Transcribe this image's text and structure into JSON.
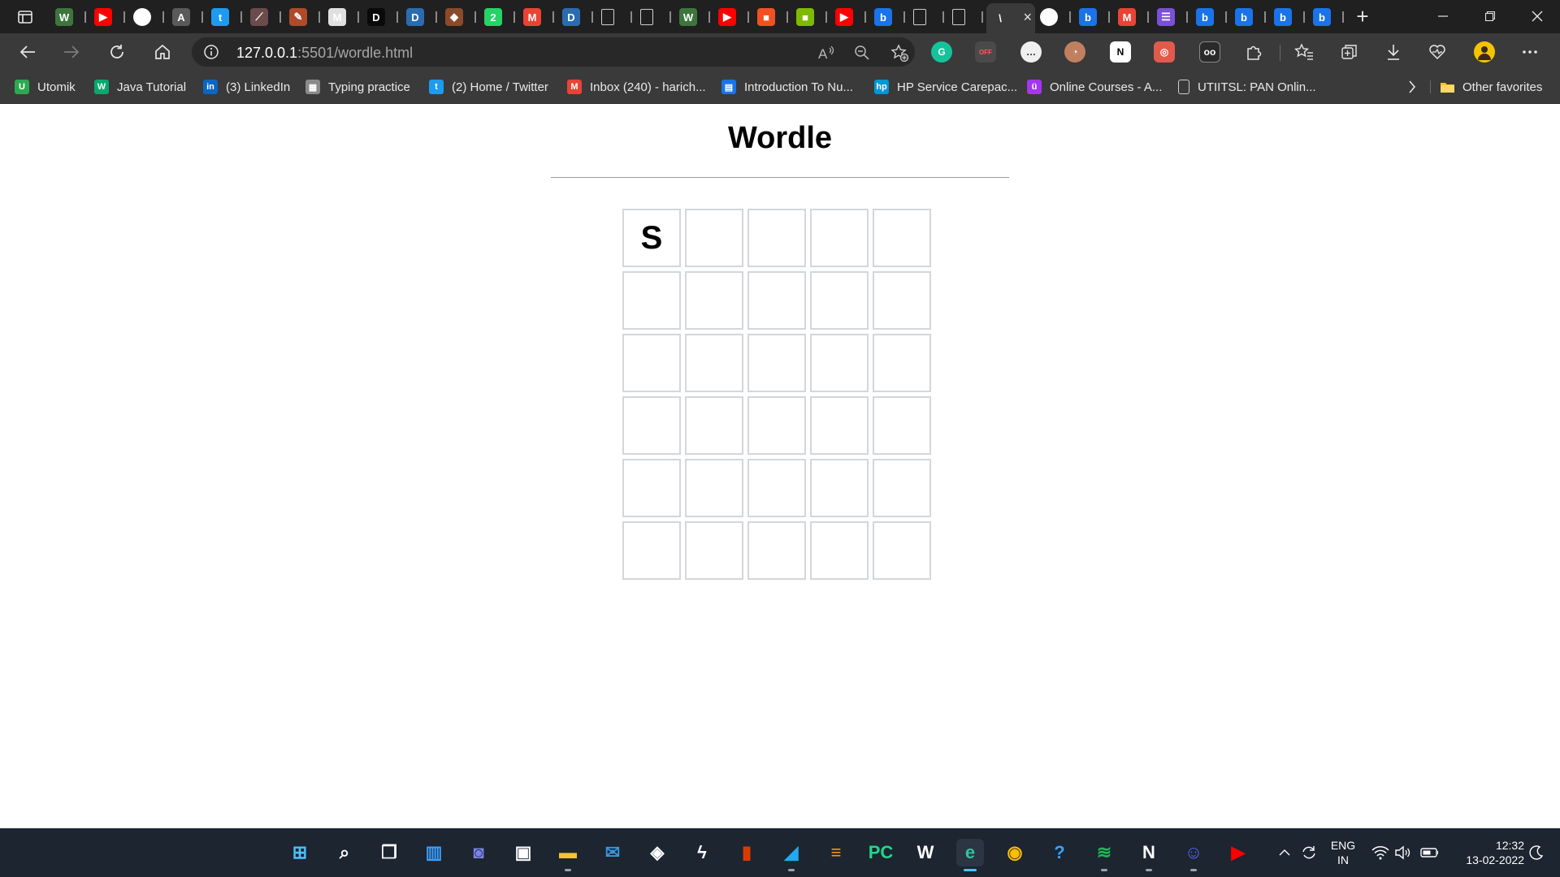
{
  "browser": {
    "tabs": [
      {
        "icon": "wikipedia-w-icon",
        "color": "#3c763d",
        "glyph": "W"
      },
      {
        "icon": "youtube-icon",
        "color": "#ff0000",
        "glyph": "▶"
      },
      {
        "icon": "github-icon",
        "color": "#ffffff",
        "glyph": ""
      },
      {
        "icon": "atlassian-a-icon",
        "color": "#5a5a5a",
        "glyph": "A"
      },
      {
        "icon": "twitter-icon",
        "color": "#1d9bf0",
        "glyph": "t"
      },
      {
        "icon": "feather-icon",
        "color": "#6b4b4b",
        "glyph": "⟋"
      },
      {
        "icon": "pencil-icon",
        "color": "#b04a2a",
        "glyph": "✎"
      },
      {
        "icon": "mw-icon",
        "color": "#e0e0e0",
        "glyph": "M"
      },
      {
        "icon": "dev-d-icon",
        "color": "#0a0a0a",
        "glyph": "D"
      },
      {
        "icon": "dev-d-blue-icon",
        "color": "#2b6cb0",
        "glyph": "D"
      },
      {
        "icon": "fox-icon",
        "color": "#8a4b2a",
        "glyph": "◆"
      },
      {
        "icon": "whatsapp-icon",
        "color": "#25d366",
        "glyph": "2"
      },
      {
        "icon": "gmail-icon",
        "color": "#ea4335",
        "glyph": "M"
      },
      {
        "icon": "dev-d-blue-icon",
        "color": "#2b6cb0",
        "glyph": "D"
      },
      {
        "icon": "document-icon",
        "color": "#5a5a5a",
        "glyph": ""
      },
      {
        "icon": "document-icon",
        "color": "#5a5a5a",
        "glyph": ""
      },
      {
        "icon": "wikipedia-w-icon",
        "color": "#3c763d",
        "glyph": "W"
      },
      {
        "icon": "youtube-icon",
        "color": "#ff0000",
        "glyph": "▶"
      },
      {
        "icon": "microsoft-icon",
        "color": "#f25022",
        "glyph": "■"
      },
      {
        "icon": "microsoft-icon",
        "color": "#7fba00",
        "glyph": "■"
      },
      {
        "icon": "youtube-icon",
        "color": "#ff0000",
        "glyph": "▶"
      },
      {
        "icon": "bing-icon",
        "color": "#1a73e8",
        "glyph": "b"
      },
      {
        "icon": "document-icon",
        "color": "#5a5a5a",
        "glyph": ""
      },
      {
        "icon": "document-sync-icon",
        "color": "#5a5a5a",
        "glyph": ""
      },
      {
        "icon": "active-tab-icon",
        "color": "#3a3a3a",
        "glyph": "\\",
        "active": true
      },
      {
        "icon": "github-icon",
        "color": "#ffffff",
        "glyph": ""
      },
      {
        "icon": "bing-icon",
        "color": "#1a73e8",
        "glyph": "b"
      },
      {
        "icon": "gmail-icon",
        "color": "#ea4335",
        "glyph": "M"
      },
      {
        "icon": "list-icon",
        "color": "#7b4fd9",
        "glyph": "☰"
      },
      {
        "icon": "bing-icon",
        "color": "#1a73e8",
        "glyph": "b"
      },
      {
        "icon": "bing-icon",
        "color": "#1a73e8",
        "glyph": "b"
      },
      {
        "icon": "bing-icon",
        "color": "#1a73e8",
        "glyph": "b"
      },
      {
        "icon": "bing-icon",
        "color": "#1a73e8",
        "glyph": "b"
      }
    ],
    "new_tab_label": "+",
    "address": {
      "host": "127.0.0.1",
      "path": ":5501/wordle.html"
    },
    "favorites": [
      {
        "label": "Utomik",
        "icon": "utomik-icon",
        "color": "#2ea84f",
        "glyph": "U"
      },
      {
        "label": "Java Tutorial",
        "icon": "w3schools-icon",
        "color": "#04aa6d",
        "glyph": "W"
      },
      {
        "label": "(3) LinkedIn",
        "icon": "linkedin-icon",
        "color": "#0a66c2",
        "glyph": "in"
      },
      {
        "label": "Typing practice",
        "icon": "keyboard-icon",
        "color": "#8a8a8a",
        "glyph": "▦"
      },
      {
        "label": "(2) Home / Twitter",
        "icon": "twitter-icon",
        "color": "#1d9bf0",
        "glyph": "t"
      },
      {
        "label": "Inbox (240) - harich...",
        "icon": "gmail-icon",
        "color": "#ea4335",
        "glyph": "M"
      },
      {
        "label": "Introduction To Nu...",
        "icon": "notebook-icon",
        "color": "#1a73e8",
        "glyph": "▤"
      },
      {
        "label": "HP Service Carepac...",
        "icon": "hp-icon",
        "color": "#0096d6",
        "glyph": "hp"
      },
      {
        "label": "Online Courses - A...",
        "icon": "udemy-icon",
        "color": "#a435f0",
        "glyph": "ü"
      },
      {
        "label": "UTIITSL: PAN Onlin...",
        "icon": "document-icon",
        "color": "#5a5a5a",
        "glyph": ""
      }
    ],
    "other_favorites_label": "Other favorites"
  },
  "page": {
    "title": "Wordle",
    "board": [
      [
        "S",
        "",
        "",
        "",
        ""
      ],
      [
        "",
        "",
        "",
        "",
        ""
      ],
      [
        "",
        "",
        "",
        "",
        ""
      ],
      [
        "",
        "",
        "",
        "",
        ""
      ],
      [
        "",
        "",
        "",
        "",
        ""
      ],
      [
        "",
        "",
        "",
        "",
        ""
      ]
    ]
  },
  "taskbar": {
    "apps": [
      {
        "name": "windows-start-icon",
        "color": "#4cc2ff"
      },
      {
        "name": "search-icon",
        "color": "#ffffff"
      },
      {
        "name": "task-view-icon",
        "color": "#ffffff"
      },
      {
        "name": "widgets-icon",
        "color": "#3aa0ff"
      },
      {
        "name": "teams-chat-icon",
        "color": "#7b83eb"
      },
      {
        "name": "microsoft-store-icon",
        "color": "#ffffff"
      },
      {
        "name": "file-explorer-icon",
        "color": "#f4c430",
        "running": true
      },
      {
        "name": "mail-icon",
        "color": "#3a96dd"
      },
      {
        "name": "dropbox-icon",
        "color": "#ffffff"
      },
      {
        "name": "lightning-app-icon",
        "color": "#ffffff"
      },
      {
        "name": "office-icon",
        "color": "#d83b01"
      },
      {
        "name": "vscode-icon",
        "color": "#23a9f2",
        "running": true
      },
      {
        "name": "sublime-icon",
        "color": "#ff9800"
      },
      {
        "name": "pycharm-icon",
        "color": "#21d789"
      },
      {
        "name": "wordweb-icon",
        "color": "#ffffff"
      },
      {
        "name": "edge-icon",
        "color": "#2fc4a0",
        "running": true,
        "active": true
      },
      {
        "name": "chrome-icon",
        "color": "#fbbc05"
      },
      {
        "name": "help-icon",
        "color": "#3aa0ff"
      },
      {
        "name": "spotify-icon",
        "color": "#1db954",
        "running": true
      },
      {
        "name": "notion-icon",
        "color": "#ffffff",
        "running": true
      },
      {
        "name": "discord-icon",
        "color": "#5865f2",
        "running": true
      },
      {
        "name": "youtube-icon",
        "color": "#ff0000"
      }
    ],
    "lang_line1": "ENG",
    "lang_line2": "IN",
    "time": "12:32",
    "date": "13-02-2022"
  }
}
